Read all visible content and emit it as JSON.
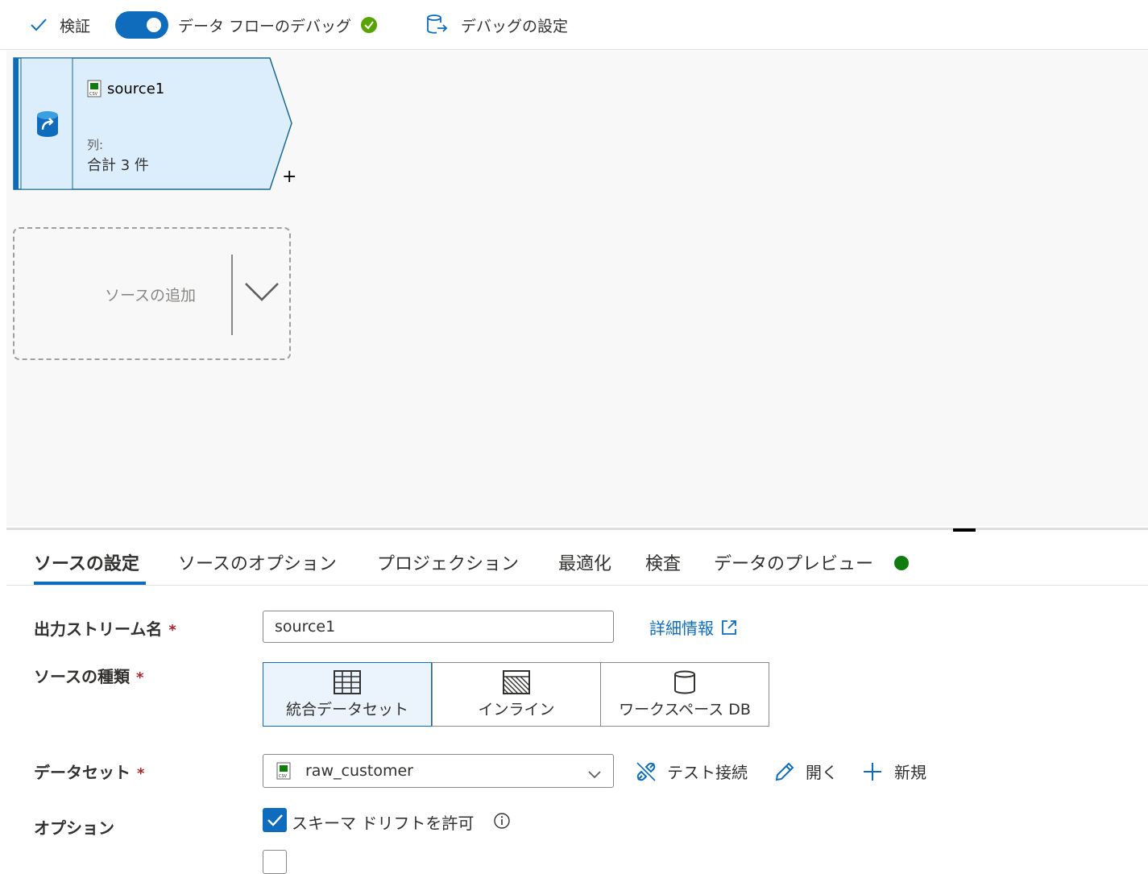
{
  "toolbar": {
    "validate_label": "検証",
    "debug_label": "データ フローのデバッグ",
    "debug_settings_label": "デバッグの設定"
  },
  "canvas": {
    "source_node": {
      "name": "source1",
      "columns_label": "列:",
      "columns_total": "合計 3 件"
    },
    "add_source_label": "ソースの追加",
    "plus_label": "+"
  },
  "tabs": [
    {
      "label": "ソースの設定"
    },
    {
      "label": "ソースのオプション"
    },
    {
      "label": "プロジェクション"
    },
    {
      "label": "最適化"
    },
    {
      "label": "検査"
    },
    {
      "label": "データのプレビュー"
    }
  ],
  "form": {
    "output_stream_label": "出力ストリーム名",
    "output_stream_value": "source1",
    "required_mark": "*",
    "learn_more_label": "詳細情報",
    "source_type_label": "ソースの種類",
    "source_types": [
      {
        "label": "統合データセット",
        "icon": "table-icon"
      },
      {
        "label": "インライン",
        "icon": "inline-icon"
      },
      {
        "label": "ワークスペース DB",
        "icon": "database-icon"
      }
    ],
    "dataset_label": "データセット",
    "dataset_value": "raw_customer",
    "test_connection_label": "テスト接続",
    "open_label": "開く",
    "new_label": "新規",
    "options_label": "オプション",
    "allow_schema_drift_label": "スキーマ ドリフトを許可"
  },
  "colors": {
    "accent": "#0f6cbd",
    "success": "#107c10",
    "node_fill": "#dceefb"
  }
}
